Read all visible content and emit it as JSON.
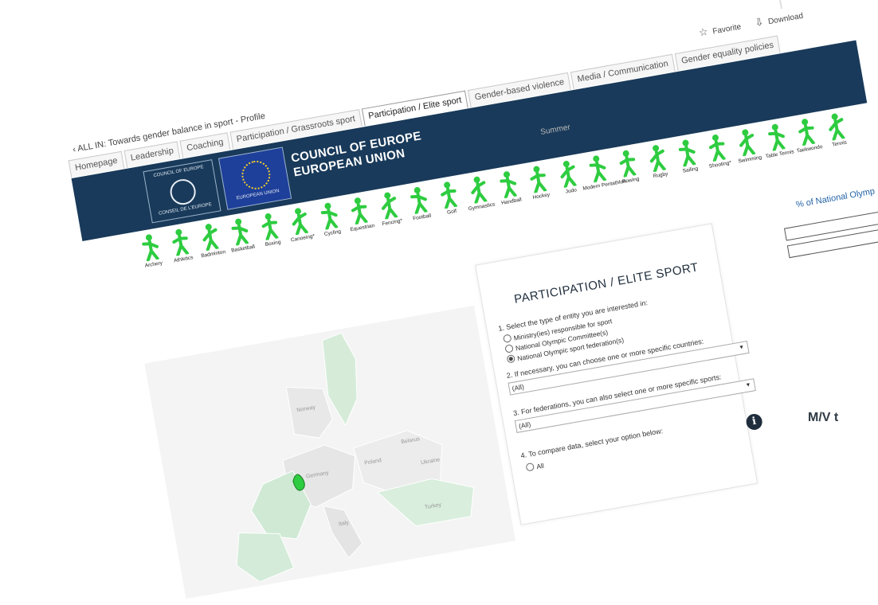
{
  "header": {
    "back_link": "ALL IN: Towards gender balance in sport - Profile",
    "favorite_label": "Favorite",
    "download_label": "Download"
  },
  "tabs": [
    {
      "label": "Homepage",
      "active": false
    },
    {
      "label": "Leadership",
      "active": false
    },
    {
      "label": "Coaching",
      "active": false
    },
    {
      "label": "Participation / Grassroots sport",
      "active": false
    },
    {
      "label": "Participation / Elite sport",
      "active": true
    },
    {
      "label": "Gender-based violence",
      "active": false
    },
    {
      "label": "Media / Communication",
      "active": false
    },
    {
      "label": "Gender equality policies",
      "active": false
    }
  ],
  "banner": {
    "title_line1": "COUNCIL OF EUROPE",
    "title_line2": "EUROPEAN UNION",
    "coe_logo_top": "COUNCIL OF EUROPE",
    "coe_logo_bottom": "CONSEIL DE L'EUROPE",
    "eu_logo_text": "EUROPEAN UNION",
    "season": "Summer"
  },
  "colors": {
    "banner": "#193a5a",
    "sport_icon": "#2ecc40",
    "accent_blue": "#2463a6"
  },
  "sports": [
    "Archery",
    "Athletics",
    "Badminton",
    "Basketball",
    "Boxing",
    "Canoeing*",
    "Cycling",
    "Equestrian",
    "Fencing*",
    "Football",
    "Golf",
    "Gymnastics",
    "Handball",
    "Hockey",
    "Judo",
    "Modern Pentathlon",
    "Rowing",
    "Rugby",
    "Sailing",
    "Shooting*",
    "Swimming",
    "Table Tennis",
    "Taekwondo",
    "Tennis"
  ],
  "right_panel": {
    "title": "% of National Olymp"
  },
  "map": {
    "labels": [
      "Norway",
      "Belarus",
      "Poland",
      "Ukraine",
      "Germany",
      "Italy",
      "Turkey"
    ]
  },
  "filters": {
    "title": "PARTICIPATION / ELITE SPORT",
    "q1": "1. Select the type of entity you are interested in:",
    "q1_options": [
      {
        "label": "Ministry(ies) responsible for sport",
        "selected": false
      },
      {
        "label": "National Olympic Committee(s)",
        "selected": false
      },
      {
        "label": "National Olympic sport federation(s)",
        "selected": true
      }
    ],
    "q2": "2. If necessary, you can choose one or more specific countries:",
    "q2_value": "(All)",
    "q3": "3. For federations, you can also select one or more specific sports:",
    "q3_value": "(All)",
    "q4": "4. To compare data, select your option below:",
    "q4_option": "All"
  },
  "margin_text": "M/V t"
}
